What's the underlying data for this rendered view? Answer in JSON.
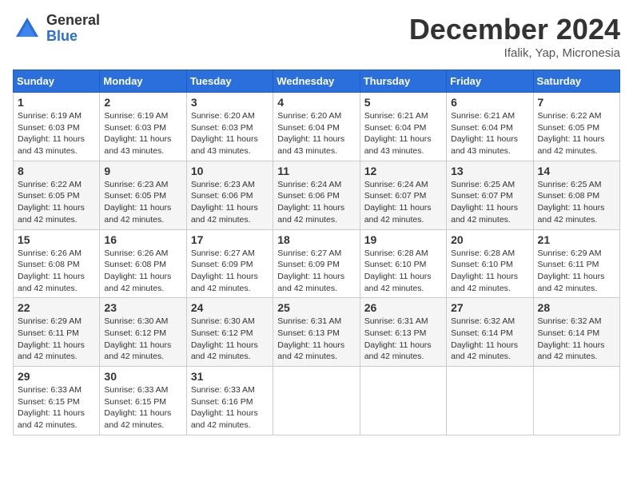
{
  "logo": {
    "general": "General",
    "blue": "Blue"
  },
  "title": "December 2024",
  "location": "Ifalik, Yap, Micronesia",
  "weekdays": [
    "Sunday",
    "Monday",
    "Tuesday",
    "Wednesday",
    "Thursday",
    "Friday",
    "Saturday"
  ],
  "weeks": [
    [
      {
        "day": "1",
        "info": "Sunrise: 6:19 AM\nSunset: 6:03 PM\nDaylight: 11 hours\nand 43 minutes."
      },
      {
        "day": "2",
        "info": "Sunrise: 6:19 AM\nSunset: 6:03 PM\nDaylight: 11 hours\nand 43 minutes."
      },
      {
        "day": "3",
        "info": "Sunrise: 6:20 AM\nSunset: 6:03 PM\nDaylight: 11 hours\nand 43 minutes."
      },
      {
        "day": "4",
        "info": "Sunrise: 6:20 AM\nSunset: 6:04 PM\nDaylight: 11 hours\nand 43 minutes."
      },
      {
        "day": "5",
        "info": "Sunrise: 6:21 AM\nSunset: 6:04 PM\nDaylight: 11 hours\nand 43 minutes."
      },
      {
        "day": "6",
        "info": "Sunrise: 6:21 AM\nSunset: 6:04 PM\nDaylight: 11 hours\nand 43 minutes."
      },
      {
        "day": "7",
        "info": "Sunrise: 6:22 AM\nSunset: 6:05 PM\nDaylight: 11 hours\nand 42 minutes."
      }
    ],
    [
      {
        "day": "8",
        "info": "Sunrise: 6:22 AM\nSunset: 6:05 PM\nDaylight: 11 hours\nand 42 minutes."
      },
      {
        "day": "9",
        "info": "Sunrise: 6:23 AM\nSunset: 6:05 PM\nDaylight: 11 hours\nand 42 minutes."
      },
      {
        "day": "10",
        "info": "Sunrise: 6:23 AM\nSunset: 6:06 PM\nDaylight: 11 hours\nand 42 minutes."
      },
      {
        "day": "11",
        "info": "Sunrise: 6:24 AM\nSunset: 6:06 PM\nDaylight: 11 hours\nand 42 minutes."
      },
      {
        "day": "12",
        "info": "Sunrise: 6:24 AM\nSunset: 6:07 PM\nDaylight: 11 hours\nand 42 minutes."
      },
      {
        "day": "13",
        "info": "Sunrise: 6:25 AM\nSunset: 6:07 PM\nDaylight: 11 hours\nand 42 minutes."
      },
      {
        "day": "14",
        "info": "Sunrise: 6:25 AM\nSunset: 6:08 PM\nDaylight: 11 hours\nand 42 minutes."
      }
    ],
    [
      {
        "day": "15",
        "info": "Sunrise: 6:26 AM\nSunset: 6:08 PM\nDaylight: 11 hours\nand 42 minutes."
      },
      {
        "day": "16",
        "info": "Sunrise: 6:26 AM\nSunset: 6:08 PM\nDaylight: 11 hours\nand 42 minutes."
      },
      {
        "day": "17",
        "info": "Sunrise: 6:27 AM\nSunset: 6:09 PM\nDaylight: 11 hours\nand 42 minutes."
      },
      {
        "day": "18",
        "info": "Sunrise: 6:27 AM\nSunset: 6:09 PM\nDaylight: 11 hours\nand 42 minutes."
      },
      {
        "day": "19",
        "info": "Sunrise: 6:28 AM\nSunset: 6:10 PM\nDaylight: 11 hours\nand 42 minutes."
      },
      {
        "day": "20",
        "info": "Sunrise: 6:28 AM\nSunset: 6:10 PM\nDaylight: 11 hours\nand 42 minutes."
      },
      {
        "day": "21",
        "info": "Sunrise: 6:29 AM\nSunset: 6:11 PM\nDaylight: 11 hours\nand 42 minutes."
      }
    ],
    [
      {
        "day": "22",
        "info": "Sunrise: 6:29 AM\nSunset: 6:11 PM\nDaylight: 11 hours\nand 42 minutes."
      },
      {
        "day": "23",
        "info": "Sunrise: 6:30 AM\nSunset: 6:12 PM\nDaylight: 11 hours\nand 42 minutes."
      },
      {
        "day": "24",
        "info": "Sunrise: 6:30 AM\nSunset: 6:12 PM\nDaylight: 11 hours\nand 42 minutes."
      },
      {
        "day": "25",
        "info": "Sunrise: 6:31 AM\nSunset: 6:13 PM\nDaylight: 11 hours\nand 42 minutes."
      },
      {
        "day": "26",
        "info": "Sunrise: 6:31 AM\nSunset: 6:13 PM\nDaylight: 11 hours\nand 42 minutes."
      },
      {
        "day": "27",
        "info": "Sunrise: 6:32 AM\nSunset: 6:14 PM\nDaylight: 11 hours\nand 42 minutes."
      },
      {
        "day": "28",
        "info": "Sunrise: 6:32 AM\nSunset: 6:14 PM\nDaylight: 11 hours\nand 42 minutes."
      }
    ],
    [
      {
        "day": "29",
        "info": "Sunrise: 6:33 AM\nSunset: 6:15 PM\nDaylight: 11 hours\nand 42 minutes."
      },
      {
        "day": "30",
        "info": "Sunrise: 6:33 AM\nSunset: 6:15 PM\nDaylight: 11 hours\nand 42 minutes."
      },
      {
        "day": "31",
        "info": "Sunrise: 6:33 AM\nSunset: 6:16 PM\nDaylight: 11 hours\nand 42 minutes."
      },
      {
        "day": "",
        "info": ""
      },
      {
        "day": "",
        "info": ""
      },
      {
        "day": "",
        "info": ""
      },
      {
        "day": "",
        "info": ""
      }
    ]
  ]
}
